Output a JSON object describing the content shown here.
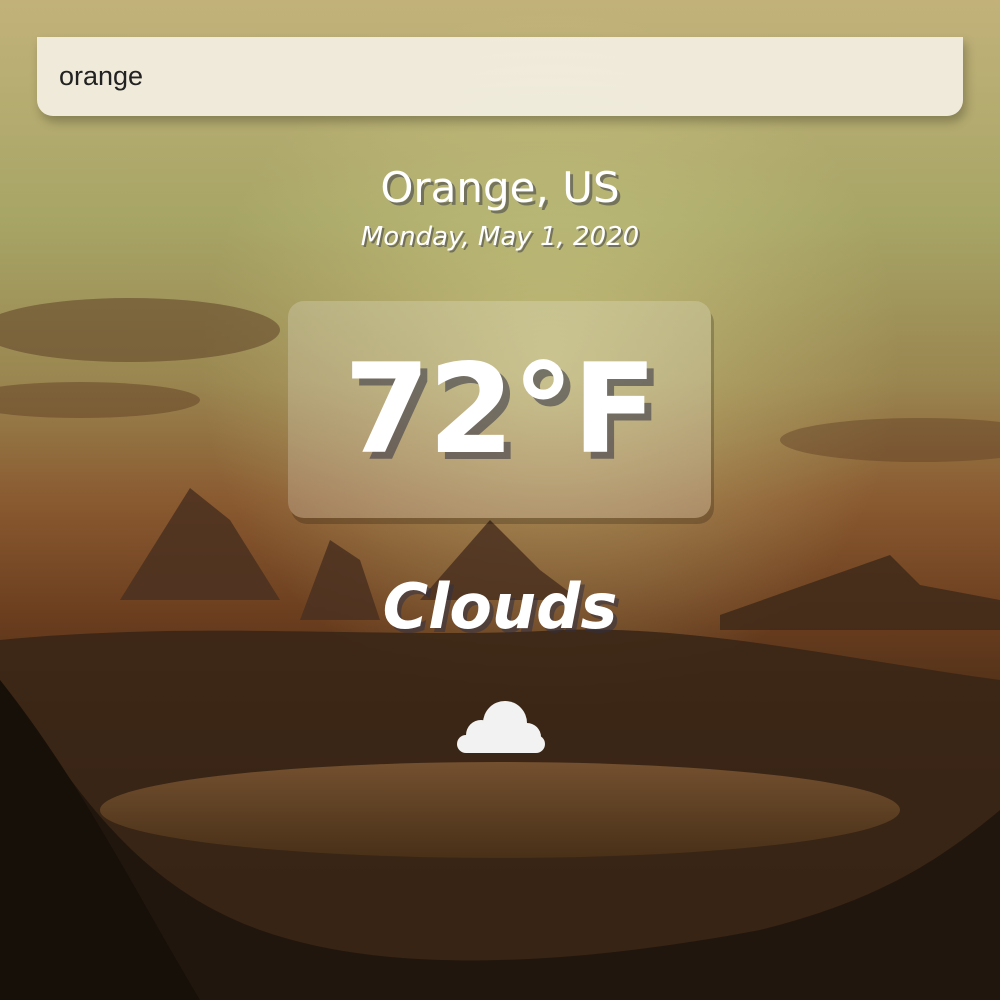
{
  "search": {
    "value": "orange",
    "placeholder": ""
  },
  "location": {
    "name": "Orange, US",
    "date": "Monday, May 1, 2020"
  },
  "weather": {
    "temperature": "72°F",
    "condition": "Clouds",
    "icon": "cloud-icon"
  },
  "colors": {
    "text": "#ffffff",
    "search_bg": "#f5f1e6"
  }
}
